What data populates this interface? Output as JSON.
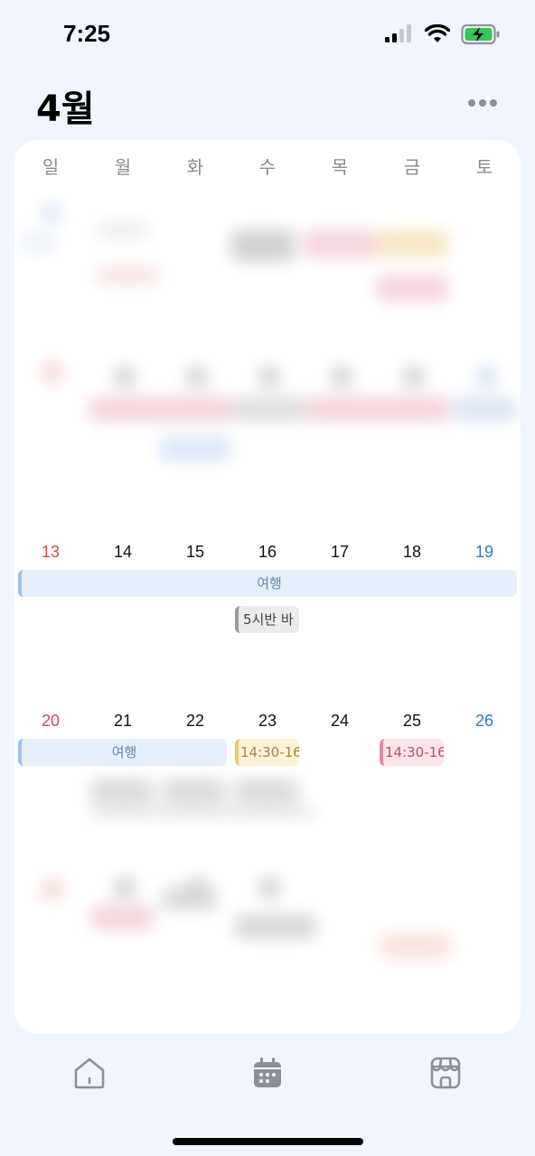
{
  "status_bar": {
    "time": "7:25",
    "icons": [
      "signal-icon",
      "wifi-icon",
      "battery-charging-icon"
    ],
    "battery_color": "#34c759"
  },
  "header": {
    "title": "4월",
    "more_icon": "ellipsis-icon"
  },
  "calendar": {
    "weekdays": [
      "일",
      "월",
      "화",
      "수",
      "목",
      "금",
      "토"
    ],
    "weeks": [
      {
        "days": [
          "13",
          "14",
          "15",
          "16",
          "17",
          "18",
          "19"
        ],
        "events": [
          {
            "label": "여행",
            "color": "blue"
          },
          {
            "label": "5시반 바",
            "color": "gray"
          }
        ]
      },
      {
        "days": [
          "20",
          "21",
          "22",
          "23",
          "24",
          "25",
          "26"
        ],
        "events": [
          {
            "label": "여행",
            "color": "blue"
          },
          {
            "label": "14:30-16",
            "color": "yellow"
          },
          {
            "label": "14:30-16",
            "color": "pink"
          }
        ]
      }
    ],
    "colors": {
      "sunday": "#e0443e",
      "saturday": "#2a79c4"
    }
  },
  "tab_bar": {
    "tabs": [
      {
        "icon": "home-icon"
      },
      {
        "icon": "calendar-icon",
        "active": true
      },
      {
        "icon": "store-icon"
      }
    ]
  }
}
